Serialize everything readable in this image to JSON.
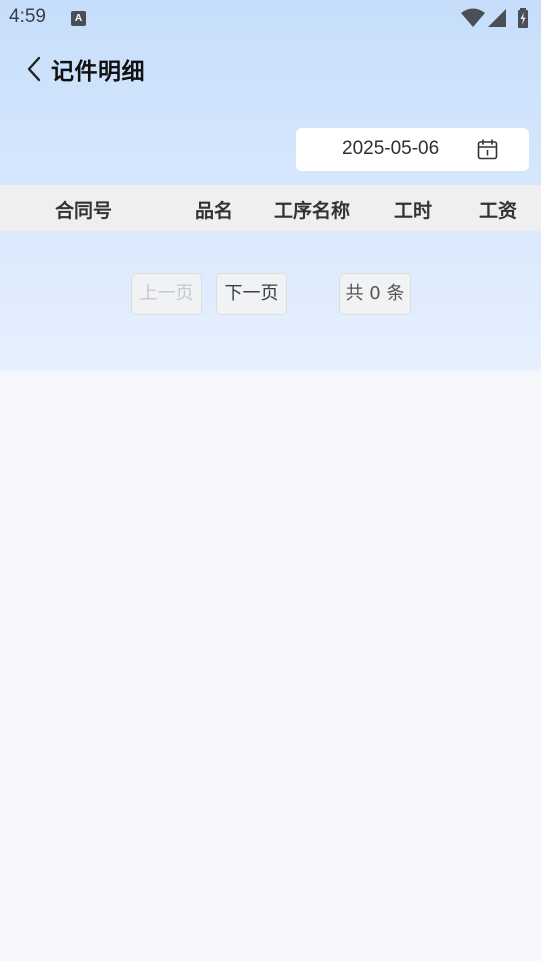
{
  "status_bar": {
    "time": "4:59",
    "notification_icon_letter": "A",
    "icons": [
      "wifi-icon",
      "cell-signal-icon",
      "battery-icon"
    ]
  },
  "header": {
    "title": "记件明细",
    "back_icon": "chevron-left-icon"
  },
  "date_filter": {
    "value": "2025-05-06",
    "icon": "calendar-icon"
  },
  "table": {
    "columns": [
      "合同号",
      "品名",
      "工序名称",
      "工时",
      "工资"
    ],
    "rows": []
  },
  "pagination": {
    "prev_label": "上一页",
    "next_label": "下一页",
    "total_label": "共 0 条"
  },
  "colors": {
    "header_gradient_top": "#c6defb",
    "header_gradient_bottom": "#e6f0fe",
    "page_background": "#f5f7fa",
    "table_header_bg": "#efefef"
  }
}
